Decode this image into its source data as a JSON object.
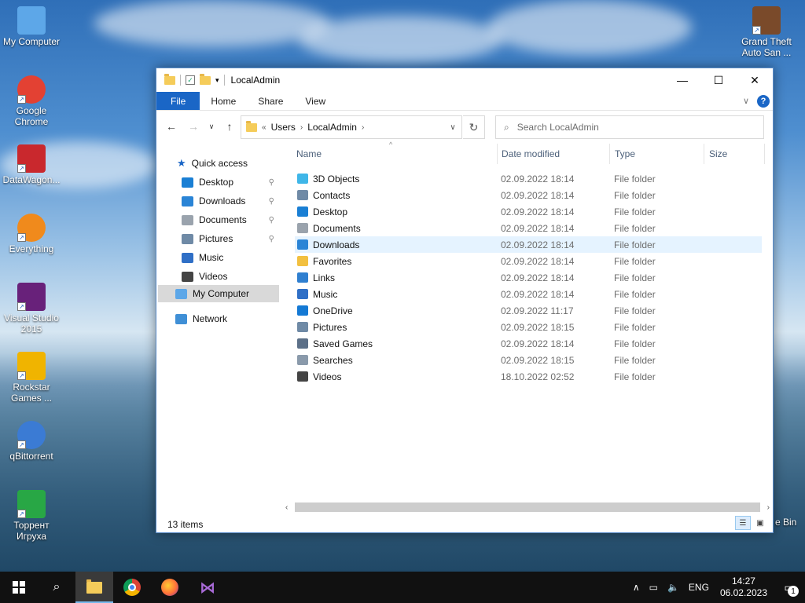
{
  "desktop": {
    "icons": [
      {
        "label": "My Computer",
        "icon": "computer-icon",
        "color": "#5da7e8"
      },
      {
        "label": "Google Chrome",
        "icon": "chrome-icon",
        "color": "#e34133"
      },
      {
        "label": "DataWagon...",
        "icon": "datawagon-icon",
        "color": "#c9282d"
      },
      {
        "label": "Everything",
        "icon": "everything-icon",
        "color": "#f08a1c"
      },
      {
        "label": "Visual Studio 2015",
        "icon": "visual-studio-icon",
        "color": "#68217a"
      },
      {
        "label": "Rockstar Games ...",
        "icon": "rockstar-icon",
        "color": "#f0b400"
      },
      {
        "label": "qBittorrent",
        "icon": "qbittorrent-icon",
        "color": "#3b7bd4"
      },
      {
        "label": "Торрент Игруха",
        "icon": "torrent-igruha-icon",
        "color": "#28a745"
      }
    ],
    "right_icon": {
      "label": "Grand Theft Auto San ...",
      "icon": "gta-icon"
    },
    "recycle_label": "e Bin"
  },
  "window": {
    "title": "LocalAdmin",
    "controls": {
      "minimize": "—",
      "maximize": "☐",
      "close": "✕"
    },
    "ribbon": {
      "file": "File",
      "home": "Home",
      "share": "Share",
      "view": "View",
      "expand": "∨",
      "help": "?"
    },
    "address": {
      "prefix": "«",
      "crumbs": [
        "Users",
        "LocalAdmin"
      ],
      "sep": "›"
    },
    "search_placeholder": "Search LocalAdmin",
    "nav_pane": {
      "quick_access": "Quick access",
      "quick_items": [
        {
          "label": "Desktop",
          "icon": "desktop-icon",
          "pinned": true
        },
        {
          "label": "Downloads",
          "icon": "downloads-icon",
          "pinned": true
        },
        {
          "label": "Documents",
          "icon": "documents-icon",
          "pinned": true
        },
        {
          "label": "Pictures",
          "icon": "pictures-icon",
          "pinned": true
        },
        {
          "label": "Music",
          "icon": "music-icon",
          "pinned": false
        },
        {
          "label": "Videos",
          "icon": "videos-icon",
          "pinned": false
        }
      ],
      "my_computer": "My Computer",
      "network": "Network"
    },
    "columns": {
      "name": "Name",
      "date": "Date modified",
      "type": "Type",
      "size": "Size"
    },
    "files": [
      {
        "name": "3D Objects",
        "date": "02.09.2022 18:14",
        "type": "File folder",
        "icon": "3d-objects-icon"
      },
      {
        "name": "Contacts",
        "date": "02.09.2022 18:14",
        "type": "File folder",
        "icon": "contacts-icon"
      },
      {
        "name": "Desktop",
        "date": "02.09.2022 18:14",
        "type": "File folder",
        "icon": "desktop-icon"
      },
      {
        "name": "Documents",
        "date": "02.09.2022 18:14",
        "type": "File folder",
        "icon": "documents-icon"
      },
      {
        "name": "Downloads",
        "date": "02.09.2022 18:14",
        "type": "File folder",
        "icon": "downloads-icon"
      },
      {
        "name": "Favorites",
        "date": "02.09.2022 18:14",
        "type": "File folder",
        "icon": "favorites-icon"
      },
      {
        "name": "Links",
        "date": "02.09.2022 18:14",
        "type": "File folder",
        "icon": "links-icon"
      },
      {
        "name": "Music",
        "date": "02.09.2022 18:14",
        "type": "File folder",
        "icon": "music-icon"
      },
      {
        "name": "OneDrive",
        "date": "02.09.2022 11:17",
        "type": "File folder",
        "icon": "onedrive-icon"
      },
      {
        "name": "Pictures",
        "date": "02.09.2022 18:15",
        "type": "File folder",
        "icon": "pictures-icon"
      },
      {
        "name": "Saved Games",
        "date": "02.09.2022 18:14",
        "type": "File folder",
        "icon": "saved-games-icon"
      },
      {
        "name": "Searches",
        "date": "02.09.2022 18:15",
        "type": "File folder",
        "icon": "searches-icon"
      },
      {
        "name": "Videos",
        "date": "18.10.2022 02:52",
        "type": "File folder",
        "icon": "videos-icon"
      }
    ],
    "hover_row_index": 4,
    "status": "13 items"
  },
  "taskbar": {
    "language": "ENG",
    "time": "14:27",
    "date": "06.02.2023",
    "notifications": "1"
  },
  "colors": {
    "accent": "#1a66c6",
    "hover": "#e5f3ff",
    "folder": "#f5cc5a"
  }
}
